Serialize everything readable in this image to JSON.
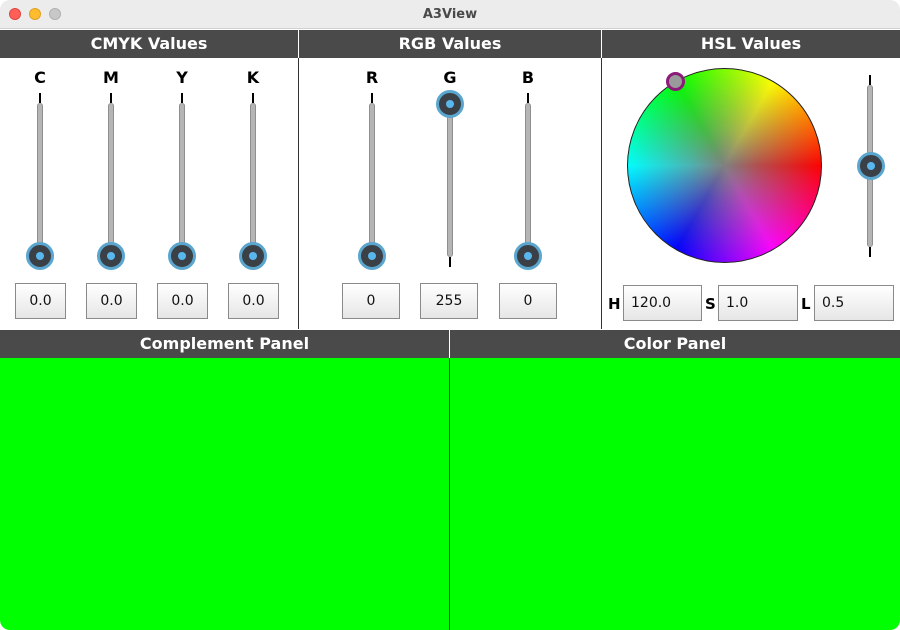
{
  "window": {
    "title": "A3View"
  },
  "cmyk": {
    "title": "CMYK Values",
    "sliders": [
      {
        "label": "C",
        "value": "0.0"
      },
      {
        "label": "M",
        "value": "0.0"
      },
      {
        "label": "Y",
        "value": "0.0"
      },
      {
        "label": "K",
        "value": "0.0"
      }
    ]
  },
  "rgb": {
    "title": "RGB Values",
    "sliders": [
      {
        "label": "R",
        "value": "0"
      },
      {
        "label": "G",
        "value": "255"
      },
      {
        "label": "B",
        "value": "0"
      }
    ]
  },
  "hsl": {
    "title": "HSL Values",
    "h_label": "H",
    "h_value": "120.0",
    "s_label": "S",
    "s_value": "1.0",
    "l_label": "L",
    "l_value": "0.5",
    "lightness_level": 0.5
  },
  "complement_panel": {
    "title": "Complement Panel",
    "color": "#00ff00"
  },
  "color_panel": {
    "title": "Color Panel",
    "color": "#00ff00"
  },
  "colors": {
    "header_bg": "#4a4a4a",
    "knob_ring": "#5aa6cf",
    "knob_dot": "#5ab7ee",
    "wheel_marker": "#8b1a78"
  }
}
